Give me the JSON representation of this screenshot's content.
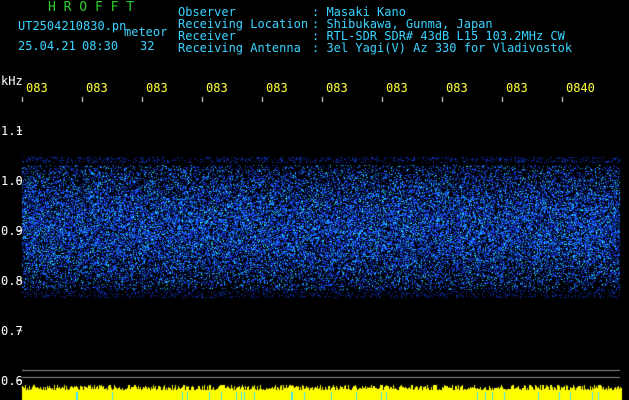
{
  "header": {
    "app_title": "H R O F F T",
    "filename": "UT2504210830.pn",
    "meteor_label": "meteor",
    "date": "25.04.21",
    "time": "08:30",
    "meteor_count": "32",
    "info_labels": [
      "Observer",
      "Receiving Location",
      "Receiver",
      "Receiving Antenna"
    ],
    "info_values": [
      ": Masaki Kano",
      ": Shibukawa, Gunma, Japan",
      ": RTL-SDR SDR# 43dB L15 103.2MHz CW",
      ": 3el Yagi(V) Az 330 for Vladivostok"
    ]
  },
  "axis": {
    "unit": "kHz",
    "y_ticks": [
      "1.1",
      "1.0",
      "0.9",
      "0.8",
      "0.7",
      "0.6"
    ],
    "time_ticks": [
      "083",
      "083",
      "083",
      "083",
      "083",
      "083",
      "083",
      "083",
      "083",
      "0840"
    ]
  },
  "colors": {
    "background": "#000000",
    "title_green": "#2ccc2c",
    "info_cyan": "#39d3ff",
    "tick_yellow": "#ffff3a",
    "signal_blue": "#1a4dff",
    "signal_cyan": "#1fd8ff"
  },
  "spectrum": {
    "band_top_khz": 1.03,
    "band_bottom_khz": 0.78,
    "density": 0.55
  }
}
